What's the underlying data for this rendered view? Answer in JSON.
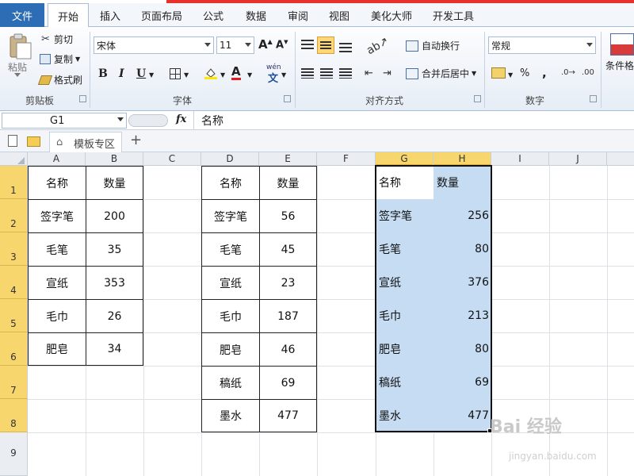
{
  "menu": {
    "file": "文件",
    "tabs": [
      "开始",
      "插入",
      "页面布局",
      "公式",
      "数据",
      "审阅",
      "视图",
      "美化大师",
      "开发工具"
    ]
  },
  "ribbon": {
    "clipboard": {
      "paste": "粘贴",
      "cut": "剪切",
      "copy": "复制",
      "format_painter": "格式刷",
      "label": "剪贴板"
    },
    "font": {
      "name": "宋体",
      "size": "11",
      "bold": "B",
      "italic": "I",
      "underline": "U",
      "font_color_letter": "A",
      "phonetic": "wén",
      "label": "字体"
    },
    "alignment": {
      "wrap": "自动换行",
      "merge": "合并后居中",
      "label": "对齐方式"
    },
    "number": {
      "format": "常规",
      "percent": "%",
      "comma": ",",
      "label": "数字"
    },
    "styles": {
      "conditional": "条件格"
    }
  },
  "formula_bar": {
    "cell_ref": "G1",
    "fx": "fx",
    "value": "名称"
  },
  "doc_tabs": {
    "template": "模板专区",
    "add": "+"
  },
  "columns": [
    "A",
    "B",
    "C",
    "D",
    "E",
    "F",
    "G",
    "H",
    "I",
    "J"
  ],
  "rows": [
    "1",
    "2",
    "3",
    "4",
    "5",
    "6",
    "7",
    "8",
    "9"
  ],
  "table1": {
    "header": [
      "名称",
      "数量"
    ],
    "rows": [
      [
        "签字笔",
        "200"
      ],
      [
        "毛笔",
        "35"
      ],
      [
        "宣纸",
        "353"
      ],
      [
        "毛巾",
        "26"
      ],
      [
        "肥皂",
        "34"
      ]
    ]
  },
  "table2": {
    "header": [
      "名称",
      "数量"
    ],
    "rows": [
      [
        "签字笔",
        "56"
      ],
      [
        "毛笔",
        "45"
      ],
      [
        "宣纸",
        "23"
      ],
      [
        "毛巾",
        "187"
      ],
      [
        "肥皂",
        "46"
      ],
      [
        "稿纸",
        "69"
      ],
      [
        "墨水",
        "477"
      ]
    ]
  },
  "table3": {
    "header": [
      "名称",
      "数量"
    ],
    "rows": [
      [
        "签字笔",
        "256"
      ],
      [
        "毛笔",
        "80"
      ],
      [
        "宣纸",
        "376"
      ],
      [
        "毛巾",
        "213"
      ],
      [
        "肥皂",
        "80"
      ],
      [
        "稿纸",
        "69"
      ],
      [
        "墨水",
        "477"
      ]
    ]
  },
  "watermark": {
    "logo": "Bai 经验",
    "url": "jingyan.baidu.com"
  },
  "colors": {
    "accent": "#2c6db5",
    "selection": "#c6dcf3",
    "header_selected": "#f8d66e",
    "red_strip": "#e8302c"
  }
}
